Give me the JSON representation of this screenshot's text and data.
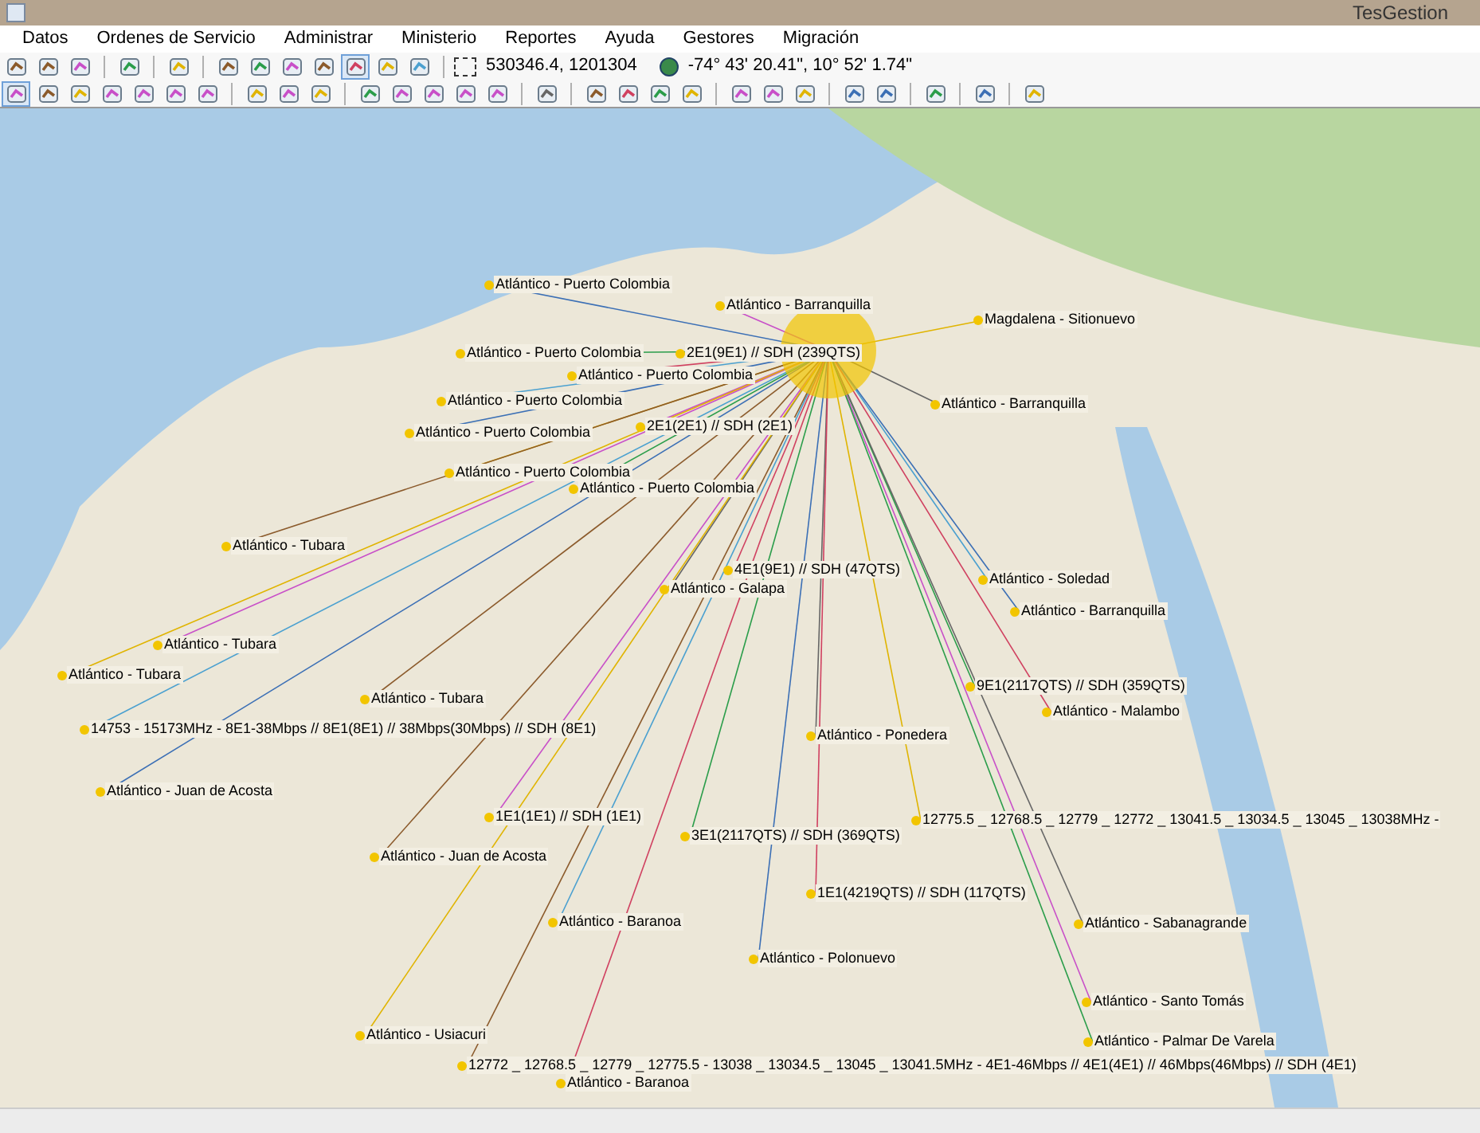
{
  "window": {
    "title": "TesGestion"
  },
  "menu": [
    "Datos",
    "Ordenes de Servicio",
    "Administrar",
    "Ministerio",
    "Reportes",
    "Ayuda",
    "Gestores",
    "Migración"
  ],
  "toolbar": {
    "coordinates": "530346.4, 1201304",
    "geo_coordinates": "-74° 43' 20.41\", 10° 52' 1.74\""
  },
  "map_labels": [
    "Atlántico - Puerto Colombia",
    "Atlántico - Barranquilla",
    "Magdalena - Sitionuevo",
    "Atlántico - Puerto Colombia",
    "2E1(9E1) // SDH (239QTS)",
    "Atlántico - Puerto Colombia",
    "Atlántico - Puerto Colombia",
    "Atlántico - Barranquilla",
    "Atlántico - Puerto Colombia",
    "2E1(2E1) // SDH (2E1)",
    "Atlántico - Puerto Colombia",
    "Atlántico - Puerto Colombia",
    "Atlántico - Tubara",
    "4E1(9E1) // SDH (47QTS)",
    "Atlántico - Soledad",
    "Atlántico - Galapa",
    "Atlántico - Barranquilla",
    "Atlántico - Tubara",
    "Atlántico - Tubara",
    "9E1(2117QTS) // SDH (359QTS)",
    "Atlántico - Tubara",
    "Atlántico - Malambo",
    "14753 - 15173MHz - 8E1-38Mbps // 8E1(8E1) // 38Mbps(30Mbps) // SDH (8E1)",
    "Atlántico - Ponedera",
    "Atlántico - Juan de Acosta",
    "1E1(1E1) // SDH (1E1)",
    "12775.5 _ 12768.5 _ 12779 _ 12772 _ 13041.5 _ 13034.5 _ 13045 _ 13038MHz -",
    "3E1(2117QTS) // SDH (369QTS)",
    "Atlántico - Juan de Acosta",
    "1E1(4219QTS) // SDH (117QTS)",
    "Atlántico - Baranoa",
    "Atlántico - Sabanagrande",
    "Atlántico - Polonuevo",
    "Atlántico - Santo Tomás",
    "Atlántico - Usiacuri",
    "Atlántico - Palmar De Varela",
    "12772 _ 12768.5 _ 12779 _ 12775.5 - 13038 _ 13034.5 _ 13045 _ 13041.5MHz - 4E1-46Mbps // 4E1(4E1) // 46Mbps(46Mbps) // SDH (4E1)",
    "Atlántico - Baranoa"
  ]
}
